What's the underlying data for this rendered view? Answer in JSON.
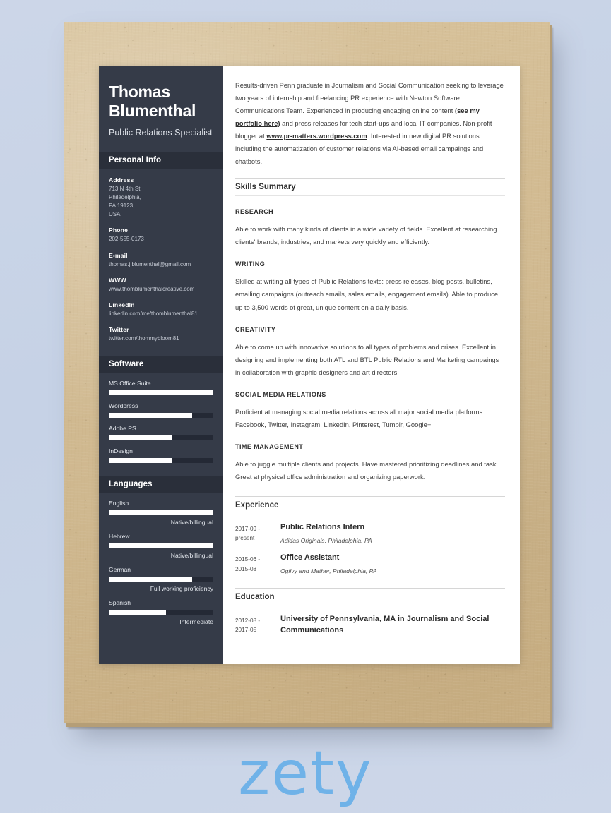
{
  "brand": {
    "wordmark": "zety",
    "color": "#6fb2e8"
  },
  "theme": {
    "sidebar_bg": "#353b48",
    "sidebar_header_bg": "#2a2f3a",
    "paper_bg": "#ffffff",
    "cardboard": "#d2bb92",
    "page_bg": "#ccd6e8",
    "bar_fill": "#ffffff",
    "bar_track": "#242935"
  },
  "sidebar": {
    "name": "Thomas Blumenthal",
    "job_title": "Public Relations Specialist",
    "personal_info_header": "Personal Info",
    "contacts": [
      {
        "label": "Address",
        "lines": [
          "713 N 4th St,",
          "Philadelphia,",
          "PA 19123,",
          "USA"
        ]
      },
      {
        "label": "Phone",
        "lines": [
          "202-555-0173"
        ]
      },
      {
        "label": "E-mail",
        "lines": [
          "thomas.j.blumenthal@gmail.com"
        ]
      },
      {
        "label": "WWW",
        "lines": [
          "www.thomblumenthalcreative.com"
        ]
      },
      {
        "label": "LinkedIn",
        "lines": [
          "linkedin.com/me/thomblumenthal81"
        ]
      },
      {
        "label": "Twitter",
        "lines": [
          "twitter.com/thommybloom81"
        ]
      }
    ],
    "software_header": "Software",
    "software": [
      {
        "name": "MS Office Suite",
        "level": 100
      },
      {
        "name": "Wordpress",
        "level": 80
      },
      {
        "name": "Adobe PS",
        "level": 60
      },
      {
        "name": "InDesign",
        "level": 60
      }
    ],
    "languages_header": "Languages",
    "languages": [
      {
        "name": "English",
        "level": 100,
        "label": "Native/billingual"
      },
      {
        "name": "Hebrew",
        "level": 100,
        "label": "Native/billingual"
      },
      {
        "name": "German",
        "level": 80,
        "label": "Full working proficiency"
      },
      {
        "name": "Spanish",
        "level": 55,
        "label": "Intermediate"
      }
    ]
  },
  "main": {
    "summary": {
      "part1": "Results-driven Penn graduate in Journalism and Social Communication seeking to leverage two years of internship and freelancing PR experience with Newton Software Communications Team. Experienced in producing engaging online content ",
      "link1": "(see my portfolio here)",
      "part2": " and press releases for tech start-ups and local IT companies. Non-profit blogger at ",
      "link2": "www.pr-matters.wordpress.com",
      "part3": ". Interested in new digital PR solutions including the automatization of customer relations via AI-based email campaings and chatbots."
    },
    "skills_header": "Skills Summary",
    "skills": [
      {
        "title": "RESEARCH",
        "body": "Able to work with many kinds of clients in a wide variety of fields. Excellent at researching clients' brands, industries, and markets very quickly and efficiently."
      },
      {
        "title": "WRITING",
        "body": "Skilled at writing all types of Public Relations texts: press releases, blog posts, bulletins, emailing campaigns (outreach emails, sales emails, engagement emails). Able to produce up to 3,500 words of great, unique content on a daily basis."
      },
      {
        "title": "CREATIVITY",
        "body": "Able to come up with innovative solutions to all types of problems and crises. Excellent in designing and implementing both ATL and BTL Public Relations and Marketing campaings in collaboration with graphic designers and art directors."
      },
      {
        "title": "SOCIAL MEDIA RELATIONS",
        "body": "Proficient at managing social media relations across all major social media platforms: Facebook, Twitter, Instagram, LinkedIn, Pinterest, Tumblr, Google+."
      },
      {
        "title": "TIME MANAGEMENT",
        "body": "Able to juggle multiple clients and projects. Have mastered prioritizing deadlines and task. Great at physical office administration and organizing paperwork."
      }
    ],
    "experience_header": "Experience",
    "experience": [
      {
        "date_from": "2017-09 -",
        "date_to": "present",
        "title": "Public Relations Intern",
        "subtitle": "Adidas Originals, Philadelphia, PA"
      },
      {
        "date_from": "2015-06 -",
        "date_to": "2015-08",
        "title": "Office Assistant",
        "subtitle": "Ogilvy and Mather, Philadelphia, PA"
      }
    ],
    "education_header": "Education",
    "education": [
      {
        "date_from": "2012-08 -",
        "date_to": "2017-05",
        "title": "University of Pennsylvania, MA in Journalism and Social Communications",
        "subtitle": ""
      }
    ]
  }
}
